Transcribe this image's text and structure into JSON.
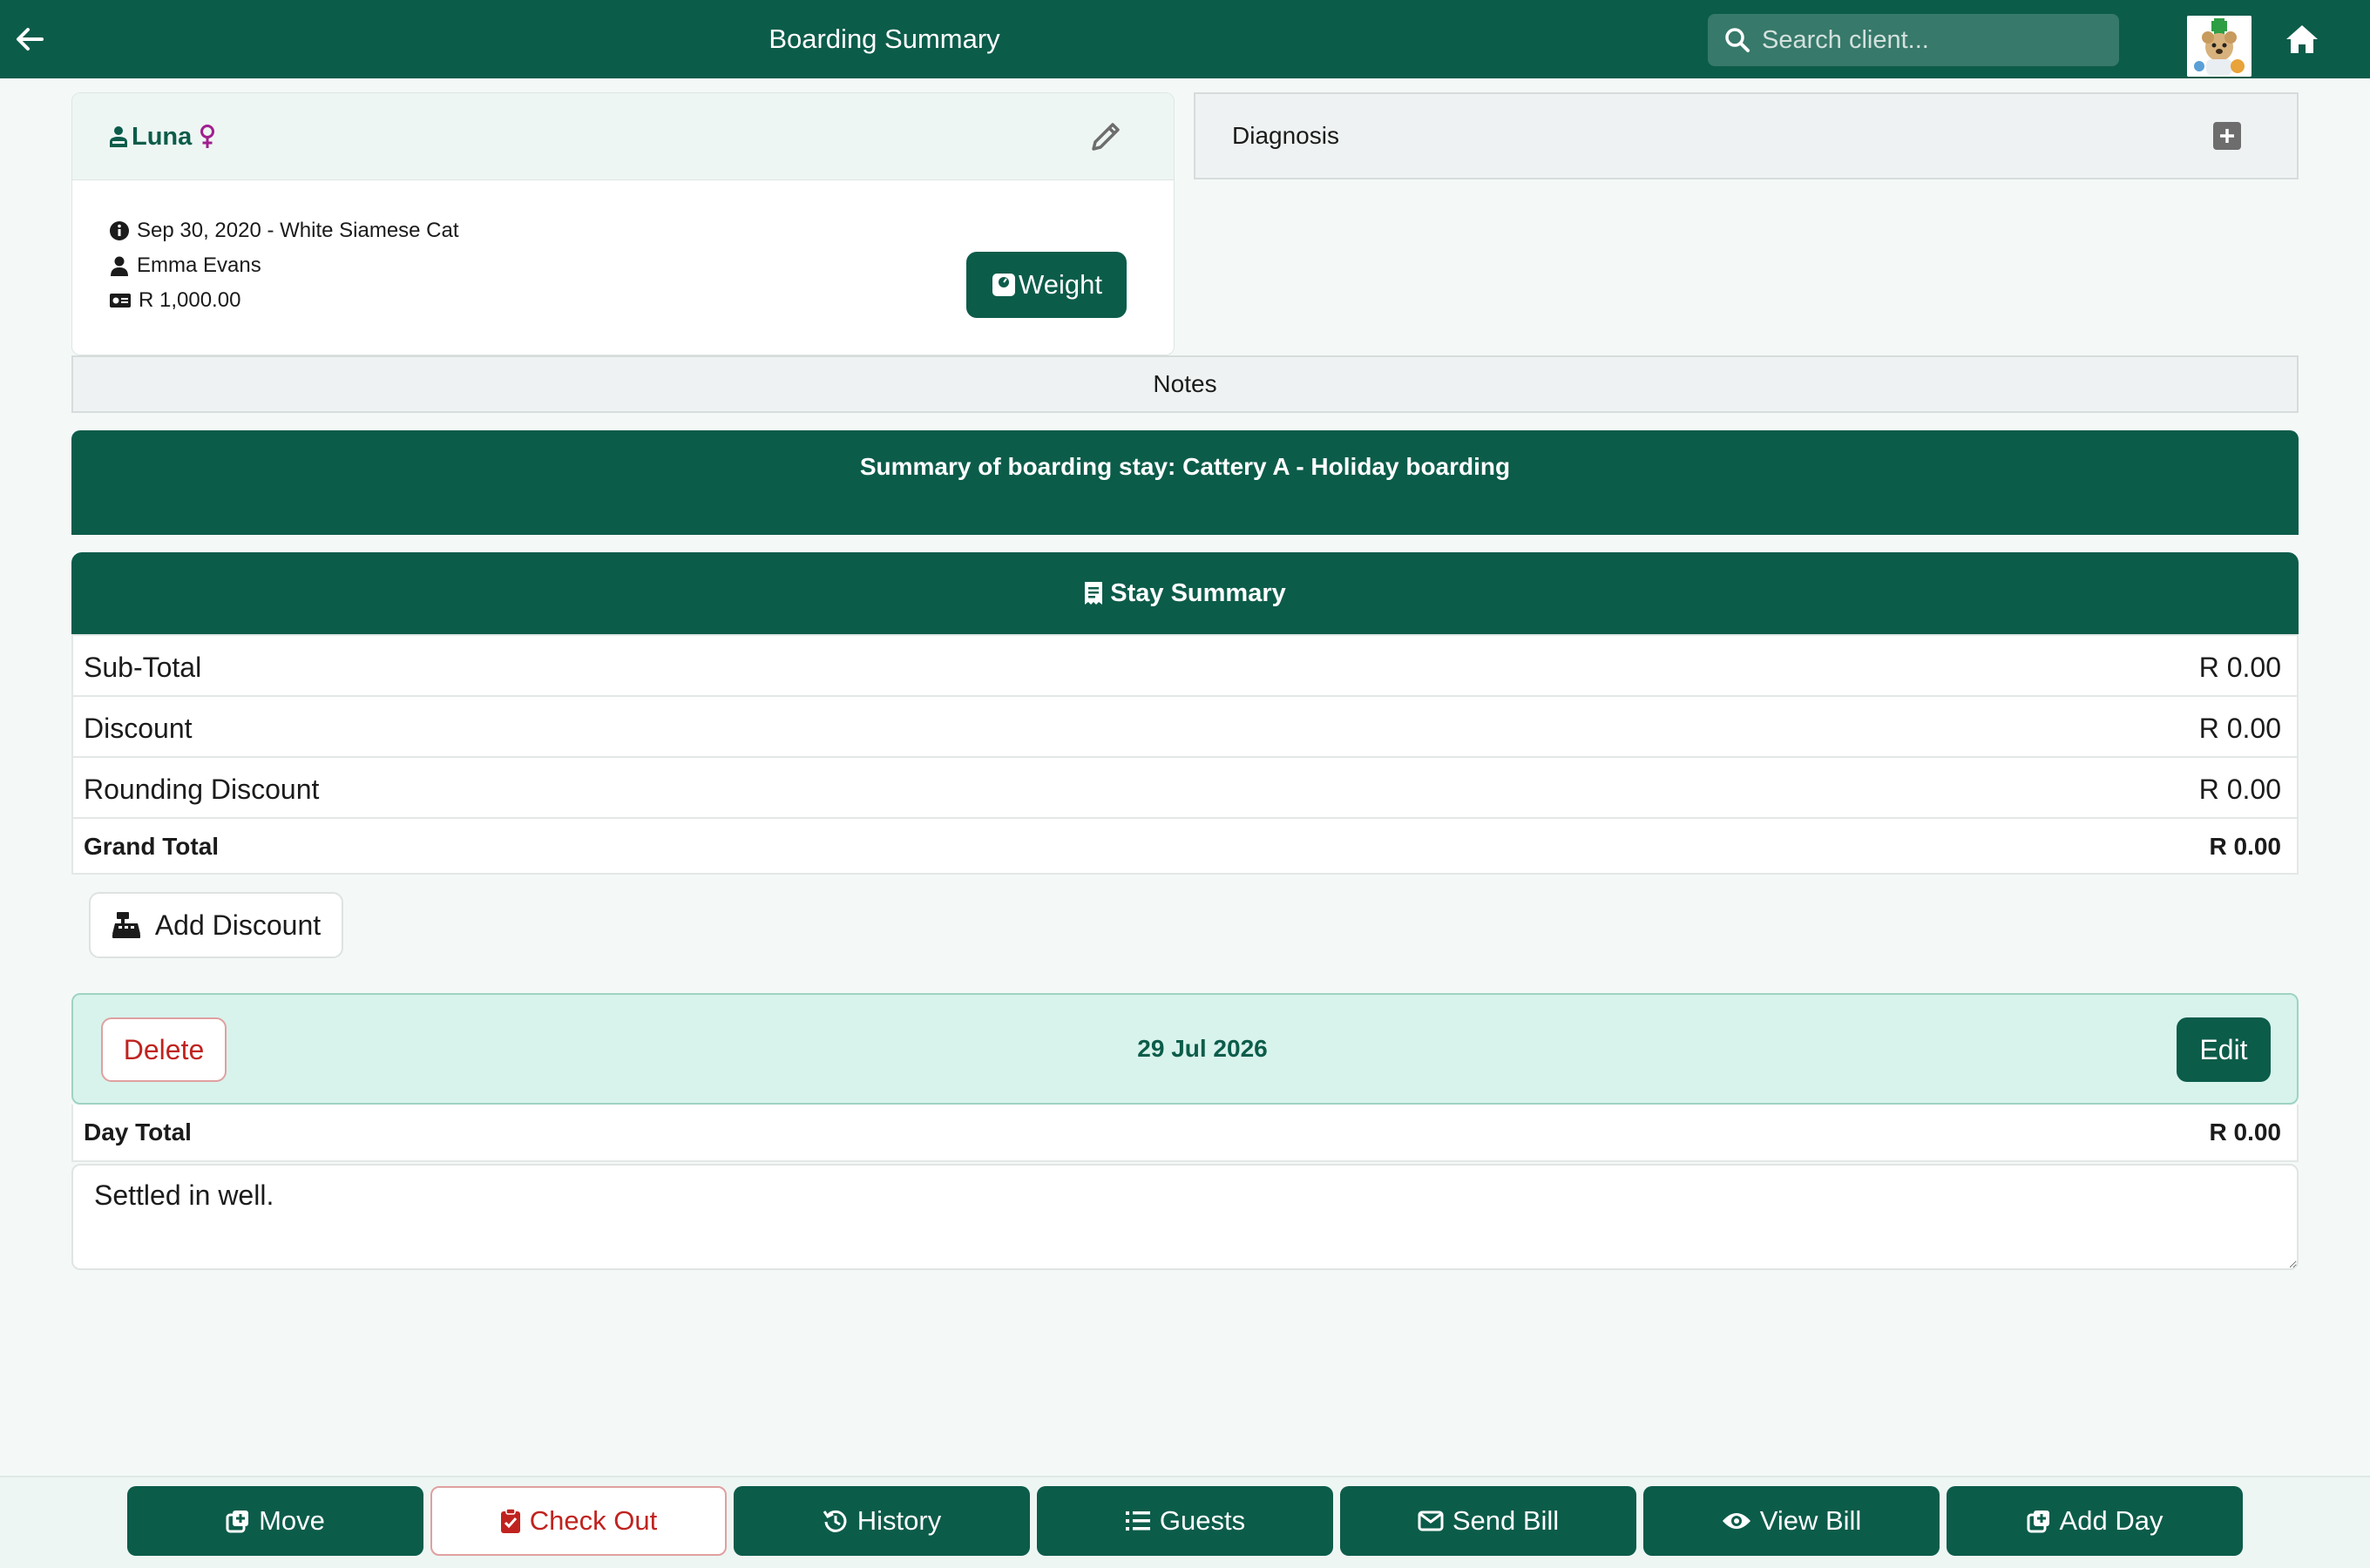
{
  "header": {
    "title": "Boarding Summary",
    "search_placeholder": "Search client...",
    "back_icon": "arrow-left-icon",
    "home_icon": "home-icon"
  },
  "patient": {
    "name": "Luna",
    "gender_symbol": "♀",
    "details_line": "Sep 30, 2020 - White Siamese Cat",
    "owner": "Emma Evans",
    "balance": "R 1,000.00",
    "weight_button": "Weight"
  },
  "diagnosis": {
    "label": "Diagnosis"
  },
  "notes": {
    "label": "Notes"
  },
  "summary_banner": "Summary of boarding stay: Cattery A - Holiday boarding",
  "stay_summary": {
    "title": "Stay Summary",
    "rows": [
      {
        "label": "Sub-Total",
        "value": "R 0.00"
      },
      {
        "label": "Discount",
        "value": "R 0.00"
      },
      {
        "label": "Rounding Discount",
        "value": "R 0.00"
      },
      {
        "label": "Grand Total",
        "value": "R 0.00"
      }
    ],
    "add_discount_button": "Add Discount"
  },
  "day": {
    "date": "29 Jul 2026",
    "delete_button": "Delete",
    "edit_button": "Edit",
    "total_label": "Day Total",
    "total_value": "R 0.00",
    "note": "Settled in well."
  },
  "bottom_bar": {
    "buttons": [
      {
        "label": "Move",
        "icon": "square-plus-icon"
      },
      {
        "label": "Check Out",
        "icon": "clipboard-check-icon"
      },
      {
        "label": "History",
        "icon": "history-icon"
      },
      {
        "label": "Guests",
        "icon": "list-icon"
      },
      {
        "label": "Send Bill",
        "icon": "envelope-icon"
      },
      {
        "label": "View Bill",
        "icon": "eye-icon"
      },
      {
        "label": "Add Day",
        "icon": "square-plus-icon"
      }
    ]
  },
  "colors": {
    "brand": "#0c5c4a",
    "danger": "#c0231f",
    "day_panel": "#d8f3ec",
    "gender": "#a01f8f"
  }
}
